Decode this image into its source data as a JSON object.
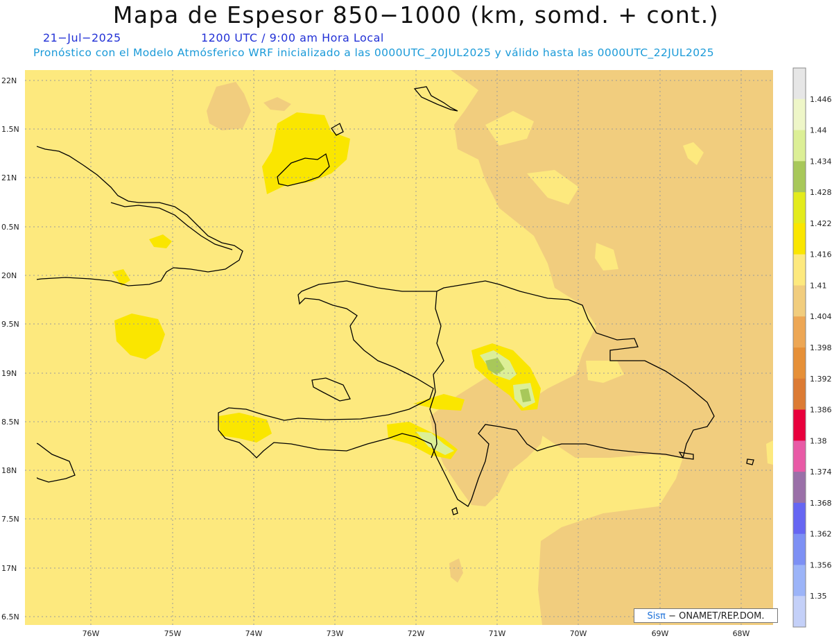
{
  "header": {
    "title": "Mapa de Espesor 850−1000 (km, somd. + cont.)",
    "date": "21−Jul−2025",
    "time": "1200 UTC / 9:00 am Hora Local",
    "description": "Pronóstico con el Modelo Atmósferico WRF inicializado a las 0000UTC_20JUL2025 y válido hasta las  0000UTC_22JUL2025"
  },
  "chart_data": {
    "type": "heatmap",
    "variable": "Espesor 850-1000",
    "units": "km",
    "lon_range": [
      -76.65,
      -67.6
    ],
    "lat_range": [
      16.4,
      22.1
    ],
    "lat_ticks": [
      "22N",
      "1.5N",
      "21N",
      "0.5N",
      "20N",
      "9.5N",
      "19N",
      "8.5N",
      "18N",
      "7.5N",
      "17N",
      "6.5N"
    ],
    "lon_ticks": [
      "76W",
      "75W",
      "74W",
      "73W",
      "72W",
      "71W",
      "70W",
      "69W",
      "68W"
    ],
    "colorbar_labels": [
      "1.446",
      "1.44",
      "1.434",
      "1.428",
      "1.422",
      "1.416",
      "1.41",
      "1.404",
      "1.398",
      "1.392",
      "1.386",
      "1.38",
      "1.374",
      "1.368",
      "1.362",
      "1.356",
      "1.35"
    ],
    "colorbar_colors": [
      "#e6e6e6",
      "#eef6c8",
      "#dcef96",
      "#a8c85a",
      "#e3eb1c",
      "#fae600",
      "#fde97e",
      "#f1cd7e",
      "#eda755",
      "#e69038",
      "#dc7b34",
      "#e8003c",
      "#e85aa6",
      "#9a70a8",
      "#6666f2",
      "#7d90f4",
      "#9cb4f8",
      "#c4d0f8"
    ],
    "grid": true,
    "background_level": "1.41-1.416",
    "colors": {
      "base": "#fde97e",
      "low": "#f1cd7e",
      "high": "#fae600",
      "higher": "#dcef96",
      "highest": "#a8c85a"
    }
  },
  "credit": {
    "brand": "Sisπ",
    "text": " − ONAMET/REP.DOM."
  }
}
